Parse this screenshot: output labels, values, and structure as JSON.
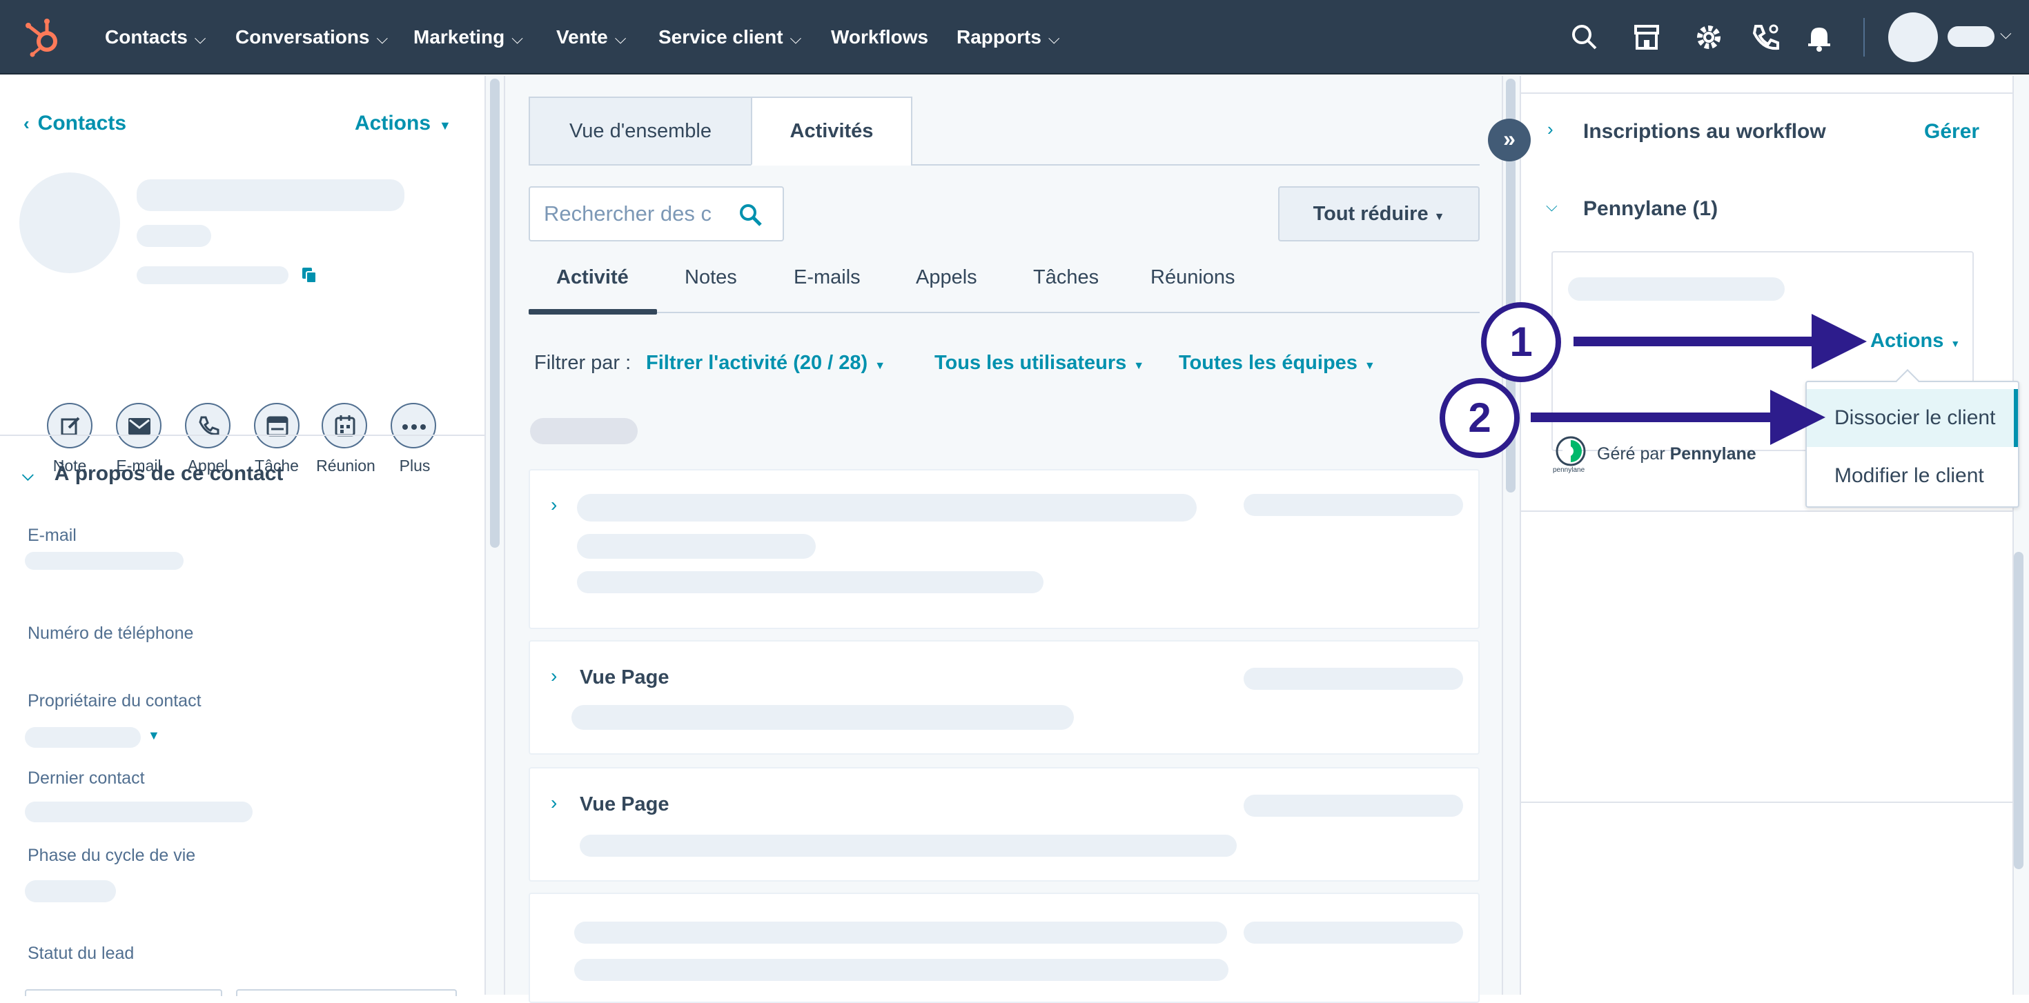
{
  "nav": {
    "items": [
      {
        "label": "Contacts",
        "caret": true
      },
      {
        "label": "Conversations",
        "caret": true
      },
      {
        "label": "Marketing",
        "caret": true
      },
      {
        "label": "Vente",
        "caret": true
      },
      {
        "label": "Service client",
        "caret": true
      },
      {
        "label": "Workflows",
        "caret": false
      },
      {
        "label": "Rapports",
        "caret": true
      }
    ],
    "icons": [
      "search-icon",
      "marketplace-icon",
      "gear-icon",
      "calling-icon",
      "bell-icon"
    ]
  },
  "left": {
    "back_link": "Contacts",
    "actions": "Actions",
    "quick_actions": [
      "Note",
      "E-mail",
      "Appel",
      "Tâche",
      "Réunion",
      "Plus"
    ],
    "section_title": "À propos de ce contact",
    "props": [
      "E-mail",
      "Numéro de téléphone",
      "Propriétaire du contact",
      "Dernier contact",
      "Phase du cycle de vie",
      "Statut du lead"
    ]
  },
  "middle": {
    "tabs": [
      "Vue d'ensemble",
      "Activités"
    ],
    "search_placeholder": "Rechercher des c",
    "collapse_all": "Tout réduire",
    "subtabs": [
      "Activité",
      "Notes",
      "E-mails",
      "Appels",
      "Tâches",
      "Réunions"
    ],
    "filter_label": "Filtrer par :",
    "filter_activity": "Filtrer l'activité (20 / 28)",
    "filter_users": "Tous les utilisateurs",
    "filter_teams": "Toutes les équipes",
    "card_titles": [
      "Vue Page",
      "Vue Page"
    ]
  },
  "right": {
    "workflow_title": "Inscriptions au workflow",
    "workflow_manage": "Gérer",
    "pennylane_title": "Pennylane (1)",
    "actions": "Actions",
    "managed_by_prefix": "Géré par",
    "managed_by_name": "Pennylane",
    "logo_text": "pennylane",
    "menu": [
      "Dissocier le client",
      "Modifier le client"
    ]
  },
  "callouts": [
    "1",
    "2"
  ],
  "colors": {
    "nav": "#2d3e50",
    "link": "#0091ae",
    "callout": "#2d1c8c",
    "logo": "#ff7a59"
  }
}
